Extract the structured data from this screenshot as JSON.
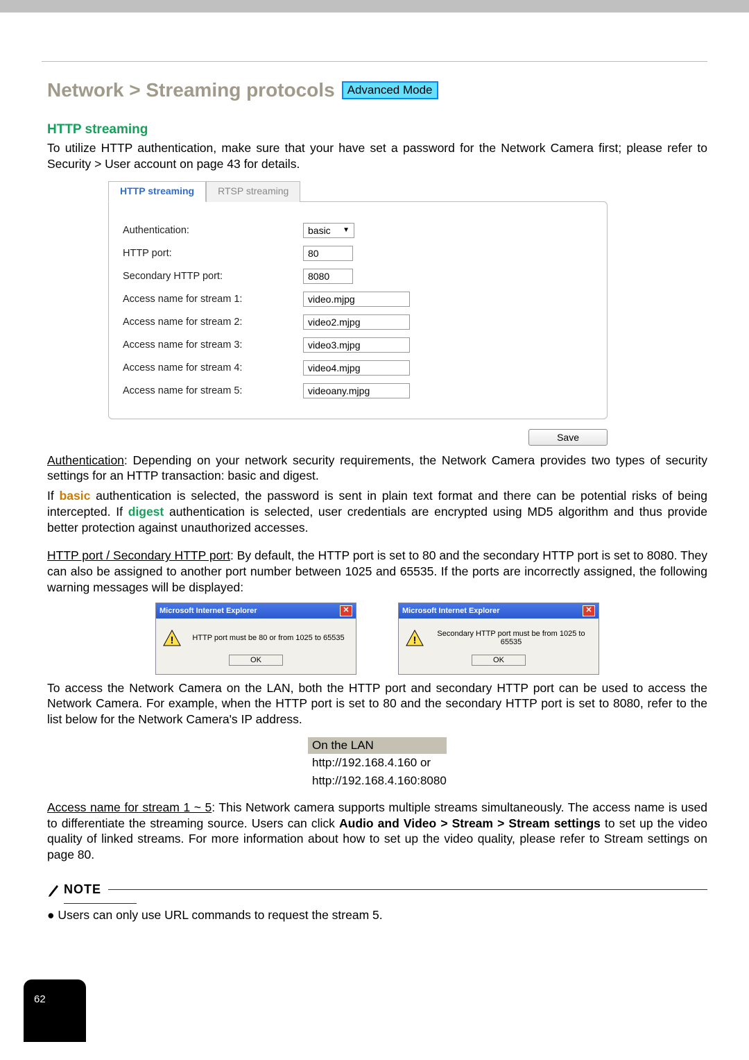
{
  "title": "Network > Streaming protocols",
  "badge": "Advanced Mode",
  "http_streaming_heading": "HTTP streaming",
  "intro1": "To utilize HTTP authentication, make sure that your have set a password for the Network Camera first; please refer to Security > User account on page 43 for details.",
  "tabs": {
    "http": "HTTP streaming",
    "rtsp": "RTSP streaming"
  },
  "form": {
    "auth_label": "Authentication:",
    "auth_value": "basic",
    "http_port_label": "HTTP port:",
    "http_port_value": "80",
    "sec_port_label": "Secondary HTTP port:",
    "sec_port_value": "8080",
    "s1_label": "Access name for stream 1:",
    "s1_value": "video.mjpg",
    "s2_label": "Access name for stream 2:",
    "s2_value": "video2.mjpg",
    "s3_label": "Access name for stream 3:",
    "s3_value": "video3.mjpg",
    "s4_label": "Access name for stream 4:",
    "s4_value": "video4.mjpg",
    "s5_label": "Access name for stream 5:",
    "s5_value": "videoany.mjpg",
    "save": "Save"
  },
  "auth_para_lead": "Authentication",
  "auth_para_rest": ": Depending on your network security requirements, the Network Camera provides two types of security settings for an HTTP transaction: basic and digest.",
  "auth_para2_a": "If ",
  "auth_para2_basic": "basic",
  "auth_para2_b": " authentication is selected, the password is sent in plain text format and there can be potential risks of being intercepted. If ",
  "auth_para2_digest": "digest",
  "auth_para2_c": " authentication is selected, user credentials are encrypted using MD5 algorithm and thus provide better protection against unauthorized accesses.",
  "port_lead": "HTTP port / Secondary HTTP port",
  "port_rest": ": By default, the HTTP port is set to 80 and the secondary HTTP port is set to 8080. They can also be assigned to another port number between 1025 and 65535. If the ports are incorrectly assigned, the following warning messages will be displayed:",
  "dialog": {
    "title": "Microsoft Internet Explorer",
    "msg1": "HTTP port must be 80 or from 1025 to 65535",
    "msg2": "Secondary HTTP port must be from 1025 to 65535",
    "ok": "OK"
  },
  "lan_para": "To access the Network Camera on the LAN, both the HTTP port and secondary HTTP port can be used to access the Network Camera. For example, when the HTTP port is set to 80 and the secondary HTTP port is set to 8080, refer to the list below for the Network Camera's IP address.",
  "lan_header": "On the LAN",
  "lan_line1": "http://192.168.4.160  or",
  "lan_line2": "http://192.168.4.160:8080",
  "access_lead": "Access name for stream 1 ~ 5",
  "access_a": ": This Network camera supports multiple streams simultaneously. The access name is used to differentiate the streaming source. Users can click ",
  "access_b_bold": "Audio and Video > Stream > Stream settings",
  "access_c": " to set up the video quality of linked streams. For more information about how to set up the video quality, please refer to Stream settings on page 80.",
  "note_label": "NOTE",
  "note_bullet": "● Users can only use URL commands to request the stream 5.",
  "page_number": "62"
}
